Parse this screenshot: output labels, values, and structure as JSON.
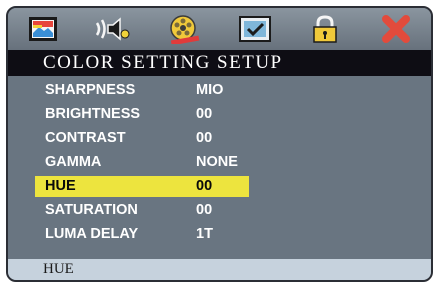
{
  "toolbar": {
    "icons": [
      {
        "name": "picture-icon"
      },
      {
        "name": "speaker-icon"
      },
      {
        "name": "film-reel-icon"
      },
      {
        "name": "checkbox-icon"
      },
      {
        "name": "lock-icon"
      },
      {
        "name": "close-icon"
      }
    ],
    "colors": {
      "accent_red": "#e24b3c",
      "accent_yellow": "#f0d23a"
    }
  },
  "title": "COLOR SETTING SETUP",
  "menu": {
    "items": [
      {
        "label": "SHARPNESS",
        "value": "MIO",
        "selected": false
      },
      {
        "label": "BRIGHTNESS",
        "value": "00",
        "selected": false
      },
      {
        "label": "CONTRAST",
        "value": "00",
        "selected": false
      },
      {
        "label": "GAMMA",
        "value": "NONE",
        "selected": false
      },
      {
        "label": "HUE",
        "value": "00",
        "selected": true
      },
      {
        "label": "SATURATION",
        "value": "00",
        "selected": false
      },
      {
        "label": "LUMA DELAY",
        "value": "1T",
        "selected": false
      }
    ],
    "highlight_color": "#ede43e"
  },
  "status": {
    "text": "HUE"
  }
}
